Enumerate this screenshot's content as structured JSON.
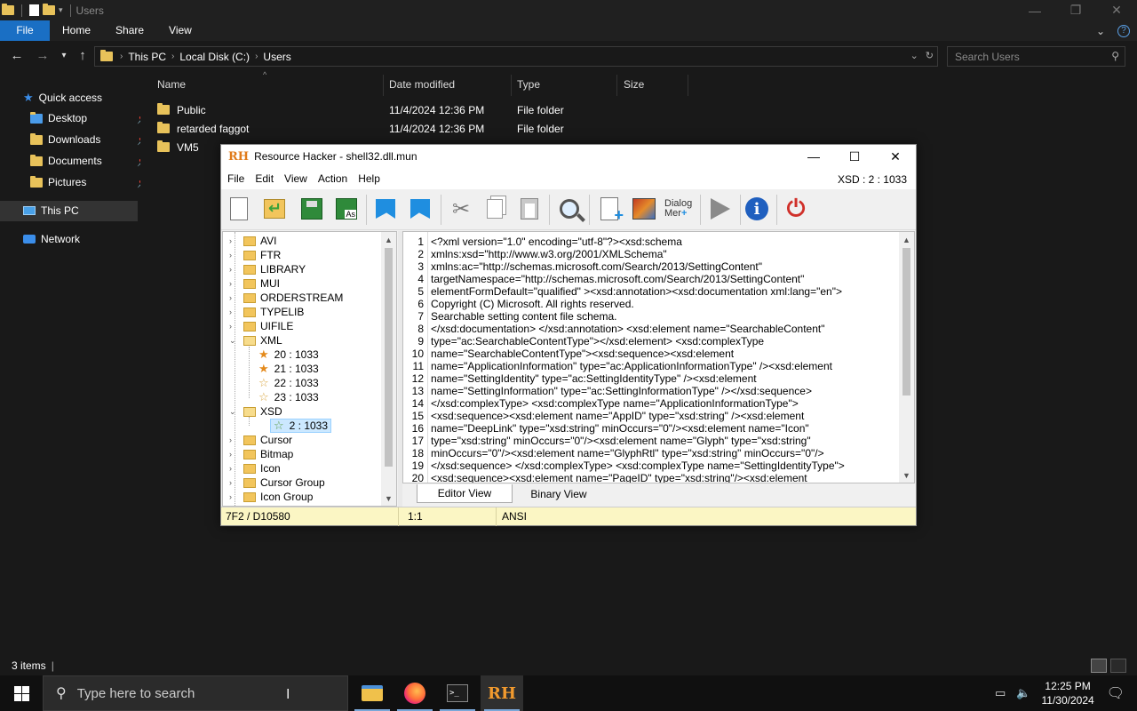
{
  "explorer": {
    "window_title": "Users",
    "ribbon_tabs": [
      "File",
      "Home",
      "Share",
      "View"
    ],
    "breadcrumb": [
      "This PC",
      "Local Disk (C:)",
      "Users"
    ],
    "search_placeholder": "Search Users",
    "nav": {
      "quick_access": "Quick access",
      "pinned": [
        "Desktop",
        "Downloads",
        "Documents",
        "Pictures"
      ],
      "this_pc": "This PC",
      "network": "Network"
    },
    "columns": [
      "Name",
      "Date modified",
      "Type",
      "Size"
    ],
    "files": [
      {
        "name": "Public",
        "date": "11/4/2024 12:36 PM",
        "type": "File folder"
      },
      {
        "name": "retarded faggot",
        "date": "11/4/2024 12:36 PM",
        "type": "File folder"
      },
      {
        "name": "VM5",
        "date": "",
        "type": ""
      }
    ],
    "status": "3 items"
  },
  "resource_hacker": {
    "logo": "RH",
    "title": "Resource Hacker - shell32.dll.mun",
    "menu": [
      "File",
      "Edit",
      "View",
      "Action",
      "Help"
    ],
    "resource_id": "XSD : 2 : 1033",
    "toolbar_dialog_label_1": "Dialog",
    "toolbar_dialog_label_2": "Mer",
    "tree": [
      {
        "label": "AVI"
      },
      {
        "label": "FTR"
      },
      {
        "label": "LIBRARY"
      },
      {
        "label": "MUI"
      },
      {
        "label": "ORDERSTREAM"
      },
      {
        "label": "TYPELIB"
      },
      {
        "label": "UIFILE"
      },
      {
        "label": "XML"
      },
      {
        "label": "20 : 1033"
      },
      {
        "label": "21 : 1033"
      },
      {
        "label": "22 : 1033"
      },
      {
        "label": "23 : 1033"
      },
      {
        "label": "XSD"
      },
      {
        "label": "2 : 1033"
      },
      {
        "label": "Cursor"
      },
      {
        "label": "Bitmap"
      },
      {
        "label": "Icon"
      },
      {
        "label": "Cursor Group"
      },
      {
        "label": "Icon Group"
      }
    ],
    "code_lines": [
      "<?xml version=\"1.0\" encoding=\"utf-8\"?><xsd:schema",
      "xmlns:xsd=\"http://www.w3.org/2001/XMLSchema\"",
      "xmlns:ac=\"http://schemas.microsoft.com/Search/2013/SettingContent\"",
      "targetNamespace=\"http://schemas.microsoft.com/Search/2013/SettingContent\"",
      "elementFormDefault=\"qualified\" ><xsd:annotation><xsd:documentation xml:lang=\"en\">",
      "Copyright (C) Microsoft. All rights reserved.",
      "Searchable setting content file schema.",
      "</xsd:documentation> </xsd:annotation> <xsd:element name=\"SearchableContent\"",
      "type=\"ac:SearchableContentType\"></xsd:element> <xsd:complexType",
      "name=\"SearchableContentType\"><xsd:sequence><xsd:element",
      "name=\"ApplicationInformation\" type=\"ac:ApplicationInformationType\" /><xsd:element",
      "name=\"SettingIdentity\" type=\"ac:SettingIdentityType\" /><xsd:element",
      "name=\"SettingInformation\" type=\"ac:SettingInformationType\" /></xsd:sequence>",
      "</xsd:complexType> <xsd:complexType name=\"ApplicationInformationType\">",
      "<xsd:sequence><xsd:element name=\"AppID\" type=\"xsd:string\" /><xsd:element",
      "name=\"DeepLink\" type=\"xsd:string\" minOccurs=\"0\"/><xsd:element name=\"Icon\"",
      "type=\"xsd:string\" minOccurs=\"0\"/><xsd:element name=\"Glyph\" type=\"xsd:string\"",
      "minOccurs=\"0\"/><xsd:element name=\"GlyphRtl\" type=\"xsd:string\" minOccurs=\"0\"/>",
      "</xsd:sequence> </xsd:complexType> <xsd:complexType name=\"SettingIdentityType\">",
      "<xsd:sequence><xsd:element name=\"PageID\" type=\"xsd:string\"/><xsd:element"
    ],
    "line_numbers": [
      "1",
      "2",
      "3",
      "4",
      "5",
      "6",
      "7",
      "8",
      "9",
      "10",
      "11",
      "12",
      "13",
      "14",
      "15",
      "16",
      "17",
      "18",
      "19",
      "20"
    ],
    "tabs": [
      "Editor View",
      "Binary View"
    ],
    "status": {
      "offset": "7F2 / D10580",
      "position": "1:1",
      "encoding": "ANSI"
    }
  },
  "taskbar": {
    "search_placeholder": "Type here to search",
    "time": "12:25 PM",
    "date": "11/30/2024"
  }
}
